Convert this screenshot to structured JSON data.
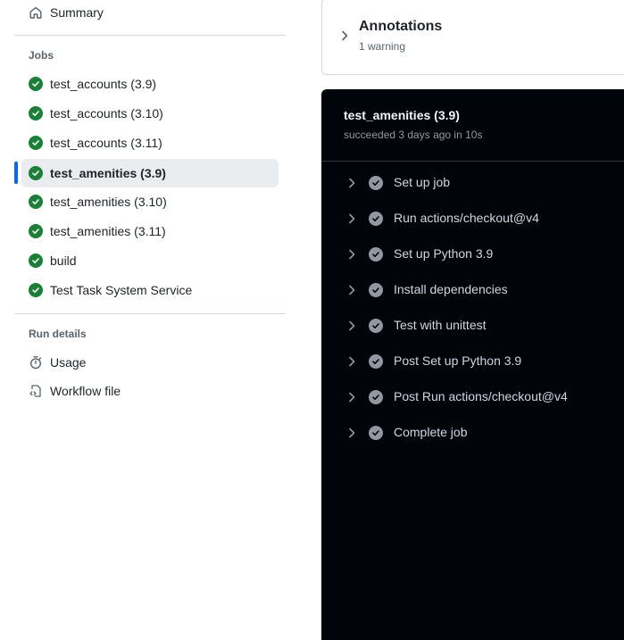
{
  "sidebar": {
    "summary_label": "Summary",
    "jobs_heading": "Jobs",
    "jobs": [
      {
        "label": "test_accounts (3.9)",
        "status": "success"
      },
      {
        "label": "test_accounts (3.10)",
        "status": "success"
      },
      {
        "label": "test_accounts (3.11)",
        "status": "success"
      },
      {
        "label": "test_amenities (3.9)",
        "status": "success",
        "selected": true
      },
      {
        "label": "test_amenities (3.10)",
        "status": "success"
      },
      {
        "label": "test_amenities (3.11)",
        "status": "success"
      },
      {
        "label": "build",
        "status": "success"
      },
      {
        "label": "Test Task System Service",
        "status": "success"
      }
    ],
    "run_details_heading": "Run details",
    "usage_label": "Usage",
    "workflow_file_label": "Workflow file"
  },
  "annotations": {
    "title": "Annotations",
    "subtitle": "1 warning"
  },
  "job_log": {
    "title": "test_amenities (3.9)",
    "subtitle": "succeeded 3 days ago in 10s",
    "steps": [
      {
        "label": "Set up job",
        "status": "success"
      },
      {
        "label": "Run actions/checkout@v4",
        "status": "success"
      },
      {
        "label": "Set up Python 3.9",
        "status": "success"
      },
      {
        "label": "Install dependencies",
        "status": "success"
      },
      {
        "label": "Test with unittest",
        "status": "success"
      },
      {
        "label": "Post Set up Python 3.9",
        "status": "success"
      },
      {
        "label": "Post Run actions/checkout@v4",
        "status": "success"
      },
      {
        "label": "Complete job",
        "status": "success"
      }
    ]
  },
  "colors": {
    "success_green": "#1a7f37",
    "selected_accent": "#0969da",
    "log_background": "#010409",
    "step_check_gray": "#9198a1"
  }
}
